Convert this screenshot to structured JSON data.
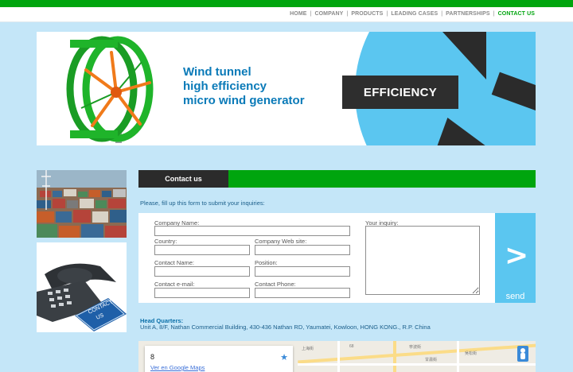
{
  "nav": {
    "items": [
      "HOME",
      "COMPANY",
      "PRODUCTS",
      "LEADING CASES",
      "PARTNERSHIPS",
      "CONTACT US"
    ],
    "active": "CONTACT US"
  },
  "banner": {
    "line1": "Wind tunnel",
    "line2": "high efficiency",
    "line3": "micro wind generator",
    "badge": "EFFICIENCY"
  },
  "side_photos": {
    "photo2_label_line1": "CONTACT",
    "photo2_label_line2": "US"
  },
  "contact": {
    "title": "Contact us",
    "intro": "Please, fill up this form to submit your inquiries:",
    "fields": {
      "company_name": "Company Name:",
      "country": "Country:",
      "company_web_site": "Company Web site:",
      "contact_name": "Contact Name:",
      "position": "Position:",
      "contact_email": "Contact e-mail:",
      "contact_phone": "Contact Phone:",
      "inquiry": "Your inquiry:"
    },
    "send_symbol": ">",
    "send_label": "send"
  },
  "hq": {
    "title": "Head Quarters:",
    "address": "Unit A, 8/F, Nathan Commercial Building, 430-436 Nathan RD, Yaumatei, Kowloon, HONG KONG., R.P. China"
  },
  "map": {
    "number": "8",
    "link": "Ver en Google Maps",
    "labels": [
      "上海街",
      "寧波街",
      "吳松街",
      "甘肅街",
      "68"
    ]
  },
  "colors": {
    "brand_green": "#00a50e",
    "sky_blue": "#5bc6f0",
    "page_bg": "#c4e6f8",
    "dark": "#2b2b2b",
    "headline_blue": "#0a7ab8"
  }
}
